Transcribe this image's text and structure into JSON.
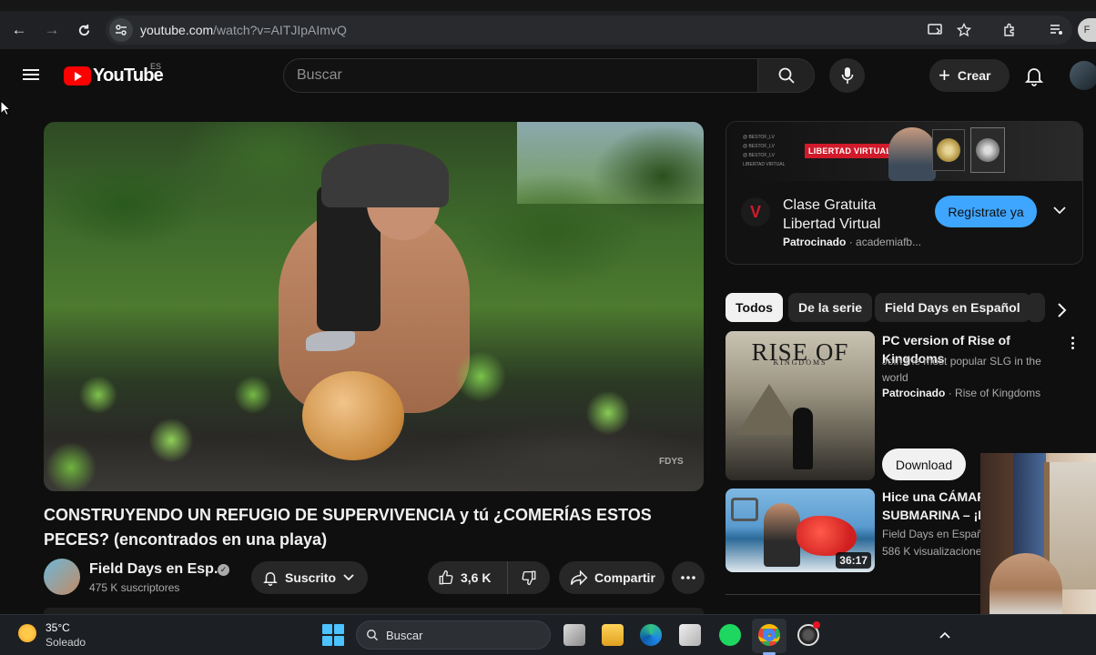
{
  "browser": {
    "url_host": "youtube.com",
    "url_path": "/watch?v=AITJIpAImvQ",
    "profile_initial": "F"
  },
  "header": {
    "logo_text": "YouTube",
    "country_code": "ES",
    "search_placeholder": "Buscar",
    "create_label": "Crear"
  },
  "video": {
    "watermark": "FDYS",
    "title": "CONSTRUYENDO UN REFUGIO DE SUPERVIVENCIA y tú ¿COMERÍAS ESTOS PECES? (encontrados en una playa)",
    "channel_name": "Field Days en Esp...",
    "subscribers": "475 K suscriptores",
    "subscribe_label": "Suscrito",
    "likes": "3,6 K",
    "share_label": "Compartir"
  },
  "ad": {
    "banner_lines": [
      "@ BESTOF_LV",
      "@ BESTOF_LV",
      "@ BESTOF_LV",
      "LIBERTAD VIRTUAL"
    ],
    "banner_badge": "LIBERTAD VIRTUAL",
    "title": "Clase Gratuita Libertad Virtual",
    "sponsored": "Patrocinado",
    "advertiser": "· academiafb...",
    "cta": "Regístrate ya"
  },
  "chips": [
    "Todos",
    "De la serie",
    "Field Days en Español"
  ],
  "related": [
    {
      "thumb_title": "RISE OF",
      "thumb_subtitle": "KINGDOMS",
      "title": "PC version of Rise of Kingdoms",
      "description": "Join the most popular SLG in the world",
      "sponsored": "Patrocinado",
      "advertiser": "· Rise of Kingdoms",
      "cta": "Download"
    },
    {
      "title_line1": "Hice una CÁMARA",
      "title_line2": "SUBMARINA – ¡P",
      "channel": "Field Days en Españ",
      "views": "586 K visualizacione",
      "duration": "36:17"
    }
  ],
  "taskbar": {
    "temperature": "35°C",
    "condition": "Soleado",
    "search_label": "Buscar"
  },
  "colors": {
    "background": "#0f0f0f",
    "brand_red": "#ff0000",
    "cta_blue": "#3ea6ff",
    "ad_badge_red": "#d11a2a"
  }
}
